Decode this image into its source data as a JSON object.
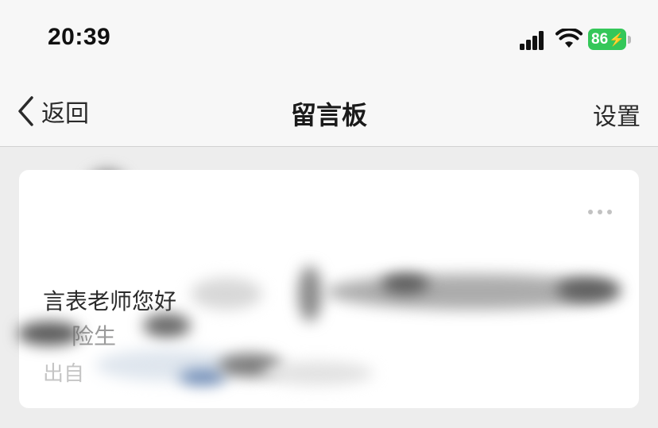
{
  "status_bar": {
    "time": "20:39",
    "battery_level": "86",
    "battery_color": "#34c759"
  },
  "nav": {
    "back_label": "返回",
    "title": "留言板",
    "settings_label": "设置"
  },
  "message_card": {
    "greeting": "言表老师您好",
    "line2_fragment": "险生",
    "line3_fragment": "出自"
  },
  "icons": {
    "back": "chevron-left-icon",
    "more": "more-horizontal-icon",
    "signal": "cellular-signal-icon",
    "wifi": "wifi-icon",
    "battery": "battery-charging-icon"
  }
}
